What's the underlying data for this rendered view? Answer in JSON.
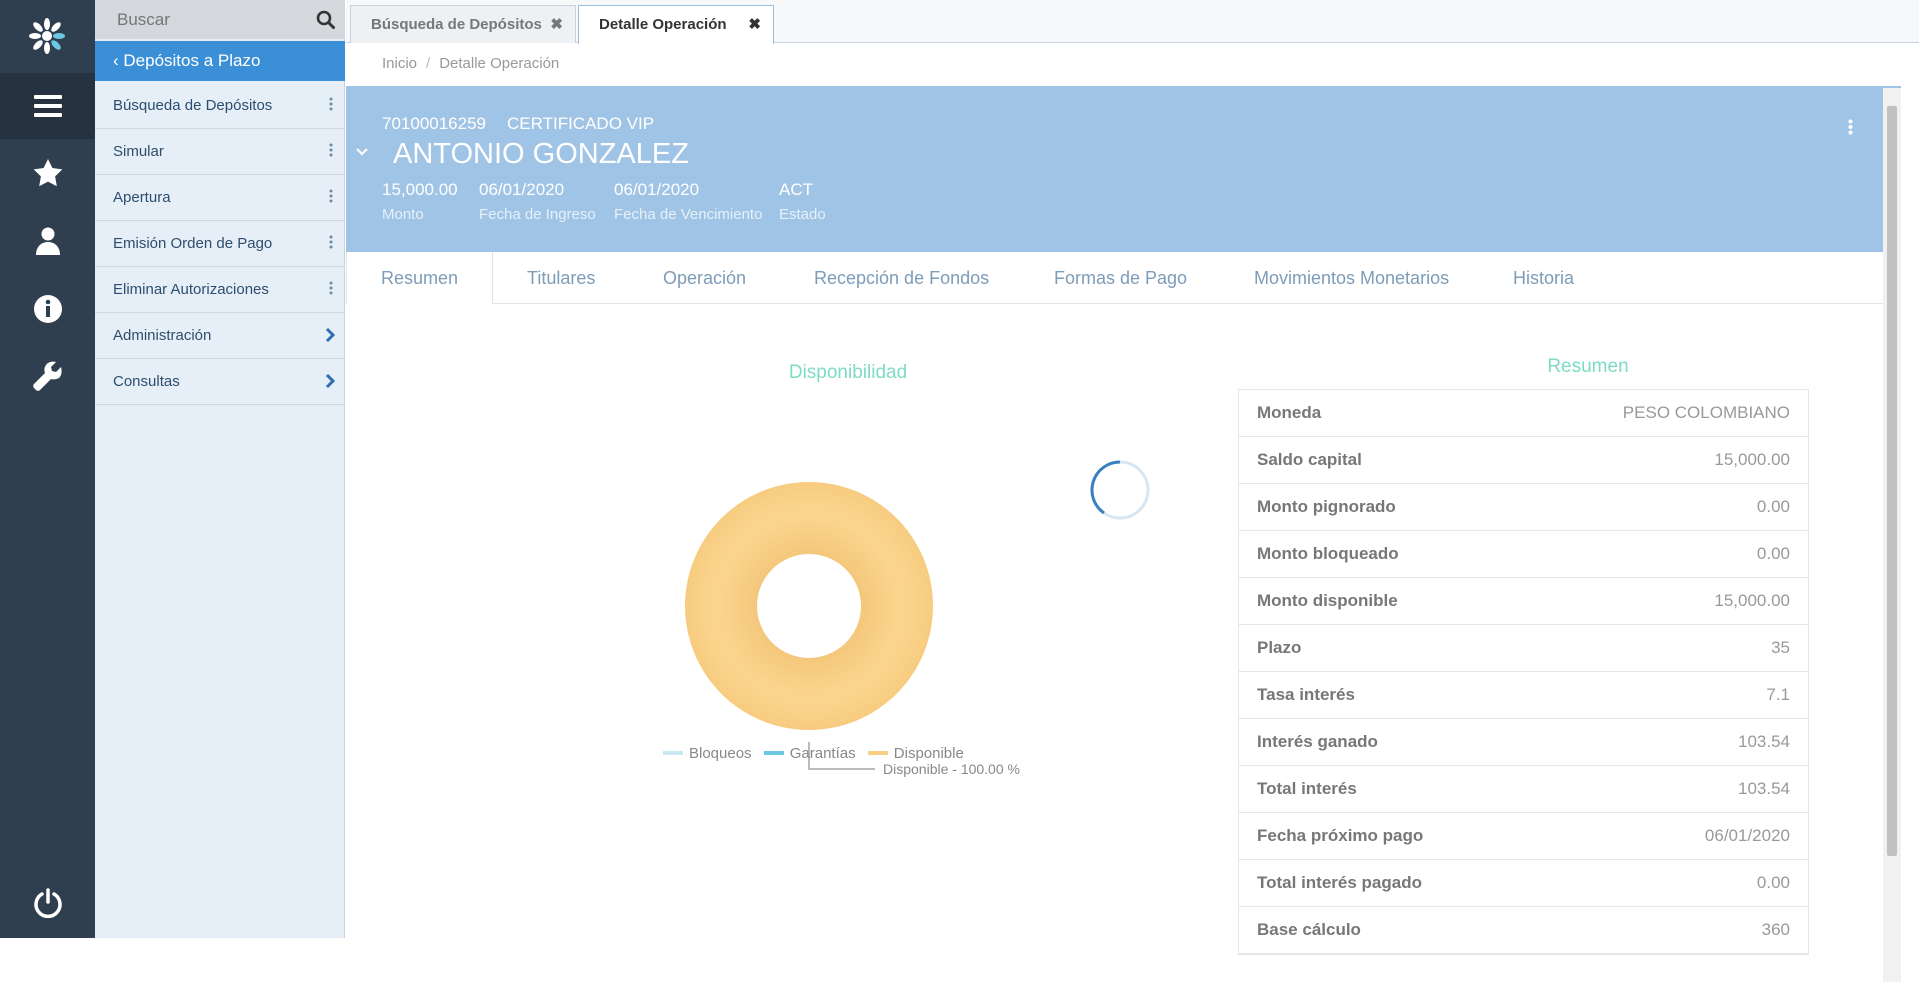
{
  "search": {
    "placeholder": "Buscar"
  },
  "sidebar": {
    "title": "‹ Depósitos a Plazo",
    "items": [
      {
        "label": "Búsqueda de Depósitos",
        "icon": "kebab-icon"
      },
      {
        "label": "Simular",
        "icon": "kebab-icon"
      },
      {
        "label": "Apertura",
        "icon": "kebab-icon"
      },
      {
        "label": "Emisión Orden de Pago",
        "icon": "kebab-icon"
      },
      {
        "label": "Eliminar Autorizaciones",
        "icon": "kebab-icon"
      },
      {
        "label": "Administración",
        "icon": "chevron-right-icon"
      },
      {
        "label": "Consultas",
        "icon": "chevron-right-icon"
      }
    ]
  },
  "rail": {
    "icons": [
      "logo-icon",
      "menu-icon",
      "star-icon",
      "user-icon",
      "info-icon",
      "wrench-icon",
      "power-icon"
    ]
  },
  "window_tabs": [
    {
      "label": "Búsqueda de Depósitos",
      "close": "✖"
    },
    {
      "label": "Detalle Operación",
      "close": "✖"
    }
  ],
  "breadcrumb": {
    "home": "Inicio",
    "sep": "/",
    "current": "Detalle Operación"
  },
  "header": {
    "account_number": "70100016259",
    "product": "CERTIFICADO VIP",
    "client_name": "ANTONIO GONZALEZ",
    "fields": [
      {
        "value": "15,000.00",
        "label": "Monto"
      },
      {
        "value": "06/01/2020",
        "label": "Fecha de Ingreso"
      },
      {
        "value": "06/01/2020",
        "label": "Fecha de Vencimiento"
      },
      {
        "value": "ACT",
        "label": "Estado"
      }
    ]
  },
  "page_tabs": [
    "Resumen",
    "Titulares",
    "Operación",
    "Recepción de Fondos",
    "Formas de Pago",
    "Movimientos Monetarios",
    "Historia"
  ],
  "chart_data": {
    "type": "pie",
    "title": "Disponibilidad",
    "categories": [
      "Bloqueos",
      "Garantías",
      "Disponible"
    ],
    "values": [
      0,
      0,
      100
    ],
    "colors": [
      "#c9e9f2",
      "#6cc8e0",
      "#f9cf84"
    ],
    "annotation": "Disponible - 100.00 %"
  },
  "summary": {
    "title": "Resumen",
    "rows": [
      {
        "key": "Moneda",
        "value": "PESO COLOMBIANO"
      },
      {
        "key": "Saldo capital",
        "value": "15,000.00"
      },
      {
        "key": "Monto pignorado",
        "value": "0.00"
      },
      {
        "key": "Monto bloqueado",
        "value": "0.00"
      },
      {
        "key": "Monto disponible",
        "value": "15,000.00"
      },
      {
        "key": "Plazo",
        "value": "35"
      },
      {
        "key": "Tasa interés",
        "value": "7.1"
      },
      {
        "key": "Interés ganado",
        "value": "103.54"
      },
      {
        "key": "Total interés",
        "value": "103.54"
      },
      {
        "key": "Fecha próximo pago",
        "value": "06/01/2020"
      },
      {
        "key": "Total interés pagado",
        "value": "0.00"
      },
      {
        "key": "Base cálculo",
        "value": "360"
      }
    ]
  }
}
